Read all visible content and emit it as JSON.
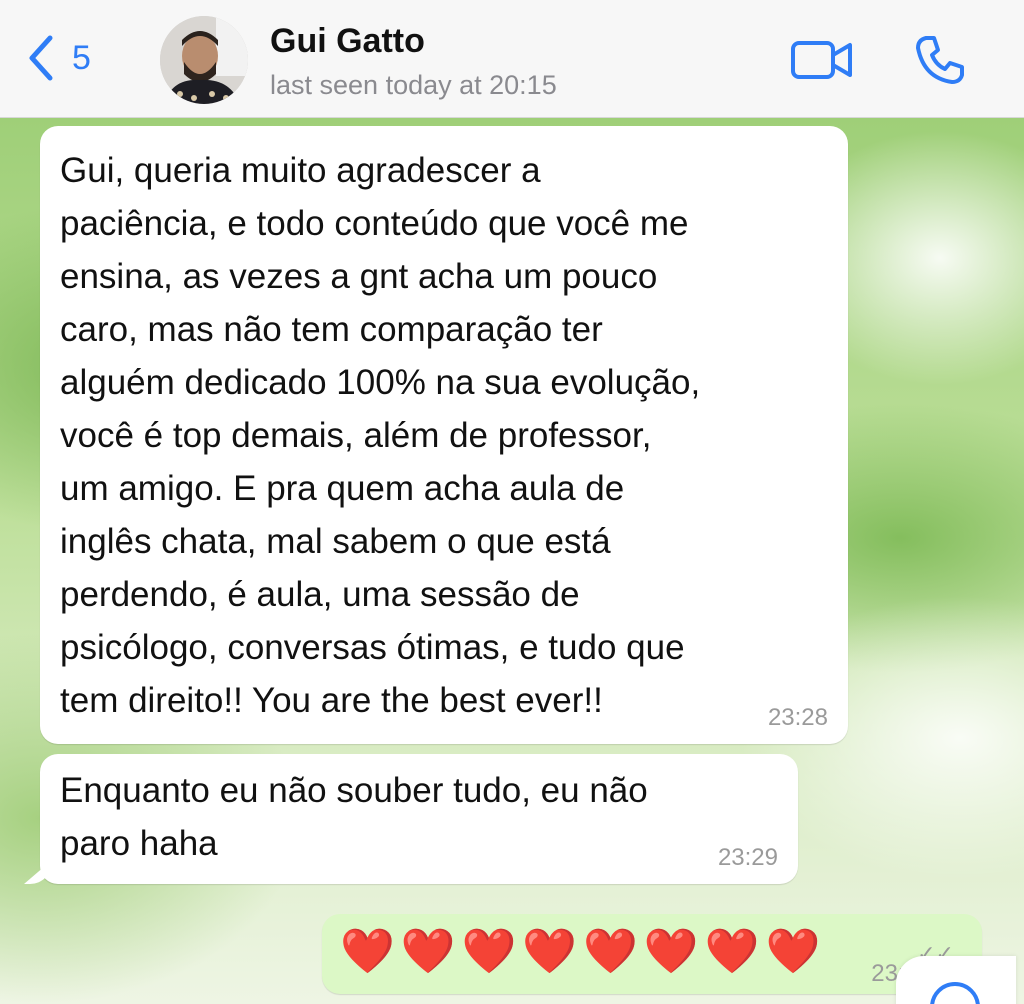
{
  "header": {
    "back_count": "5",
    "contact_name": "Gui Gatto",
    "last_seen": "last seen today at 20:15",
    "accent_color": "#2f7df6"
  },
  "messages": [
    {
      "direction": "incoming",
      "text": "Gui, queria muito agradescer a\npaciência, e todo conteúdo que você me\nensina, as vezes a gnt acha um pouco\ncaro, mas não tem comparação ter\nalguém dedicado 100% na sua evolução,\nvocê é top demais, além de professor,\num amigo. E pra quem acha aula de\ninglês chata, mal sabem o que está\nperdendo, é aula, uma sessão de\npsicólogo, conversas ótimas, e tudo que\ntem direito!! You are the best ever!!",
      "time": "23:28"
    },
    {
      "direction": "incoming",
      "text": "Enquanto eu não souber tudo, eu não\nparo haha",
      "time": "23:29"
    },
    {
      "direction": "outgoing",
      "text": "❤️❤️❤️❤️❤️❤️❤️❤️",
      "time": "23:3"
    }
  ],
  "icons": {
    "back": "chevron-left-icon",
    "video": "video-camera-icon",
    "call": "phone-icon",
    "scroll": "scroll-down-icon"
  }
}
